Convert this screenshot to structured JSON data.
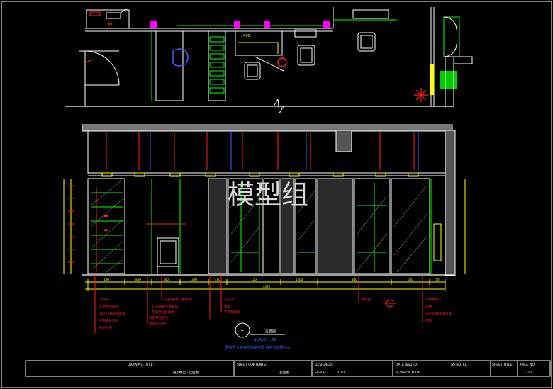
{
  "drawing": {
    "watermark": "模型组",
    "section_symbol": "F",
    "section_label": "立面图",
    "section_scale": "SCALE-1:40",
    "section_note": "硬装尺寸参考原始条件图 请务必现场核实",
    "elevation_top_dims": [
      "180",
      "860",
      "300",
      "340",
      "400",
      "120",
      "1200",
      "840",
      "600",
      "50"
    ],
    "elevation_total_dim": "4070",
    "plan_tag": "1400",
    "legend_left": [
      "木饰面",
      "黑色烤漆玻璃",
      "12mm钢化清玻璃",
      "不锈钢收口条",
      "石材台面"
    ],
    "legend_middle": [
      "成品柜体(白色烤漆)",
      "12mm钢化清玻璃",
      "不锈钢拉丝收边",
      "灰色布艺软包",
      "木饰面(深色)"
    ],
    "legend_center": [
      "乳胶漆",
      "墙纸",
      "不锈钢踢脚"
    ],
    "legend_right_a": "木饰面",
    "legend_right_b": [
      "不锈钢收口",
      "石材",
      "12mm钢化清玻璃",
      "灰镜"
    ]
  },
  "titleblock": {
    "drawing_title_label": "DRAWING TITLE:",
    "drawing_title_value": "展示模型 - 立面图",
    "sheet_contents_label": "SHEET CONTENTS:",
    "sheet_contents_value": "立面图",
    "designed_label": "DESIGNED:",
    "scale_label": "SCALE:",
    "scale_value": "1:40",
    "date_label": "DATE ISSUED:",
    "date_value": "AS NOTED",
    "revision_label": "REVISION DATE:",
    "sheet_label": "SHEET TITLE:",
    "page_label": "PAGE NO:",
    "page_value": "E-17"
  },
  "colors": {
    "background": "#000000",
    "line_white": "#ffffff",
    "line_green": "#00ff00",
    "line_red": "#ff2020",
    "line_magenta": "#ff00ff",
    "line_yellow": "#ffff00",
    "line_cyan": "#00ffff",
    "line_blue": "#4060ff",
    "watermark": "#cccccc"
  }
}
